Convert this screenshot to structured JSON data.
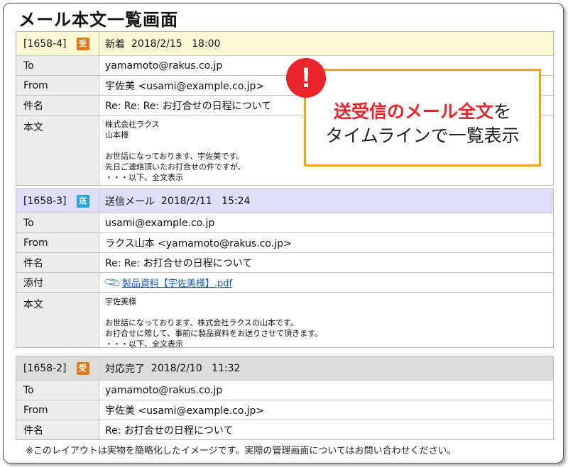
{
  "page_title": "メール本文一覧画面",
  "callout": {
    "emphasis": "送受信のメール全文",
    "emphasis_suffix": "を",
    "line2": "タイムラインで一覧表示",
    "alert_glyph": "!"
  },
  "labels": {
    "to": "To",
    "from": "From",
    "subject": "件名",
    "attachment": "添付",
    "body": "本文"
  },
  "colors": {
    "recv_badge": "#e07a16",
    "send_badge": "#24a4dd",
    "callout_border": "#f0a71e",
    "alert": "#e8252b"
  },
  "mails": [
    {
      "id": "[1658-4]",
      "badge": "受",
      "status": "新着",
      "date": "2018/2/15",
      "time": "18:00",
      "to": "yamamoto@rakus.co.jp",
      "from": "宇佐美 <usami@example.co.jp>",
      "subject": "Re: Re: Re: お打合せの日程について",
      "body": [
        "株式会社ラクス",
        "山本様",
        "",
        "お世話になっております、宇佐美です。",
        "先日ご連絡頂いたお打合せの件ですが、",
        "・・・以下、全文表示"
      ]
    },
    {
      "id": "[1658-3]",
      "badge": "送",
      "status": "送信メール",
      "date": "2018/2/11",
      "time": "15:24",
      "to": "usami@example.co.jp",
      "from": "ラクス山本 <yamamoto@rakus.co.jp>",
      "subject": "Re: Re: お打合せの日程について",
      "attachment": "製品資料【宇佐美様】.pdf",
      "body": [
        "宇佐美様",
        "",
        "お世話になっております、株式会社ラクスの山本です。",
        "お打合せに際して、事前に製品資料をお送りさせて頂きます。",
        "・・・以下、全文表示"
      ]
    },
    {
      "id": "[1658-2]",
      "badge": "受",
      "status": "対応完了",
      "date": "2018/2/10",
      "time": "11:32",
      "to": "yamamoto@rakus.co.jp",
      "from": "宇佐美 <usami@example.co.jp>",
      "subject": "Re: お打合せの日程について"
    }
  ],
  "footnote": "※このレイアウトは実物を簡略化したイメージです。実際の管理画面についてはお問い合わせください。"
}
